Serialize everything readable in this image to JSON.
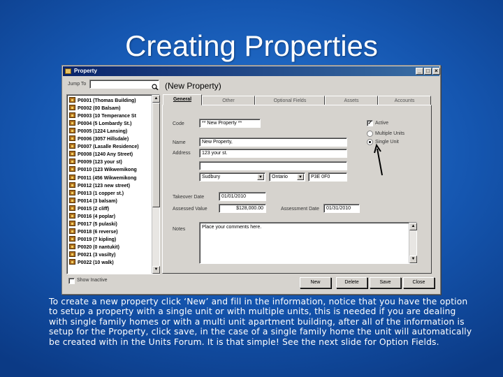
{
  "slide": {
    "title": "Creating Properties",
    "caption": "To create a new property click ‘New’ and fill in the information, notice that you have the option to setup a property with a single unit or with multiple units, this is needed if you are dealing with single family homes or with a multi unit apartment building, after all of the information is setup for the Property, click save, in the case of a single family home the unit will automatically be created with in the Units Forum. It is that simple! See the next slide for Option Fields."
  },
  "window": {
    "title": "Property",
    "controls": [
      "_",
      "□",
      "×"
    ]
  },
  "search": {
    "label": "Jump To",
    "value": "",
    "icon": "search-icon"
  },
  "header": {
    "title": "(New Property)"
  },
  "properties": [
    "P0001 (Thomas Building)",
    "P0002 (00 Balsam)",
    "P0003 (10 Temperance St",
    "P0004 (5 Lombardy St.)",
    "P0005 (1224 Lansing)",
    "P0006 (3057 Hillsdale)",
    "P0007 (Lasalle Residence)",
    "P0008 (1240 Any Street)",
    "P0009 (123 your st)",
    "P0010 (123 Wikwemikong",
    "P0011 (456 Wikwemikong",
    "P0012 (123 new street)",
    "P0013 (1 copper st.)",
    "P0014 (3 balsam)",
    "P0015 (2 cliff)",
    "P0016 (4 poplar)",
    "P0017 (5 pulaski)",
    "P0018 (6 reverse)",
    "P0019 (7 kipling)",
    "P0020 (0 nantukit)",
    "P0021 (3 vasilty)",
    "P0022 (10 walk)"
  ],
  "show_inactive": {
    "label": "Show Inactive",
    "checked": false
  },
  "tabs": [
    {
      "label": "General",
      "active": true
    },
    {
      "label": "Other",
      "active": false
    },
    {
      "label": "Optional Fields",
      "active": false
    },
    {
      "label": "Assets",
      "active": false
    },
    {
      "label": "Accounts",
      "active": false
    }
  ],
  "form": {
    "code": {
      "label": "Code",
      "value": "** New Property **"
    },
    "name": {
      "label": "Name",
      "value": "New Property,"
    },
    "address": {
      "label": "Address",
      "line1": "123 your st.",
      "line2": ""
    },
    "city": "Sudbury",
    "province": "Ontario",
    "postal": "P3E 0F0",
    "takeover": {
      "label": "Takeover Date",
      "value": "01/01/2010"
    },
    "assessed": {
      "label": "Assessed Value",
      "value": "$128,000.00"
    },
    "assessment_date": {
      "label": "Assessment Date",
      "value": "01/31/2010"
    },
    "notes": {
      "label": "Notes",
      "value": "Place your comments here."
    },
    "active": {
      "label": "Active",
      "checked": true
    },
    "unit_type": {
      "options": [
        "Multiple Units",
        "Single Unit"
      ],
      "selected": "Single Unit"
    }
  },
  "buttons": {
    "new": "New",
    "delete": "Delete",
    "save": "Save",
    "close": "Close"
  },
  "colors": {
    "slide_bg": "#1556b0",
    "titlebar": "#0a246a",
    "window_face": "#d6d3ce"
  }
}
